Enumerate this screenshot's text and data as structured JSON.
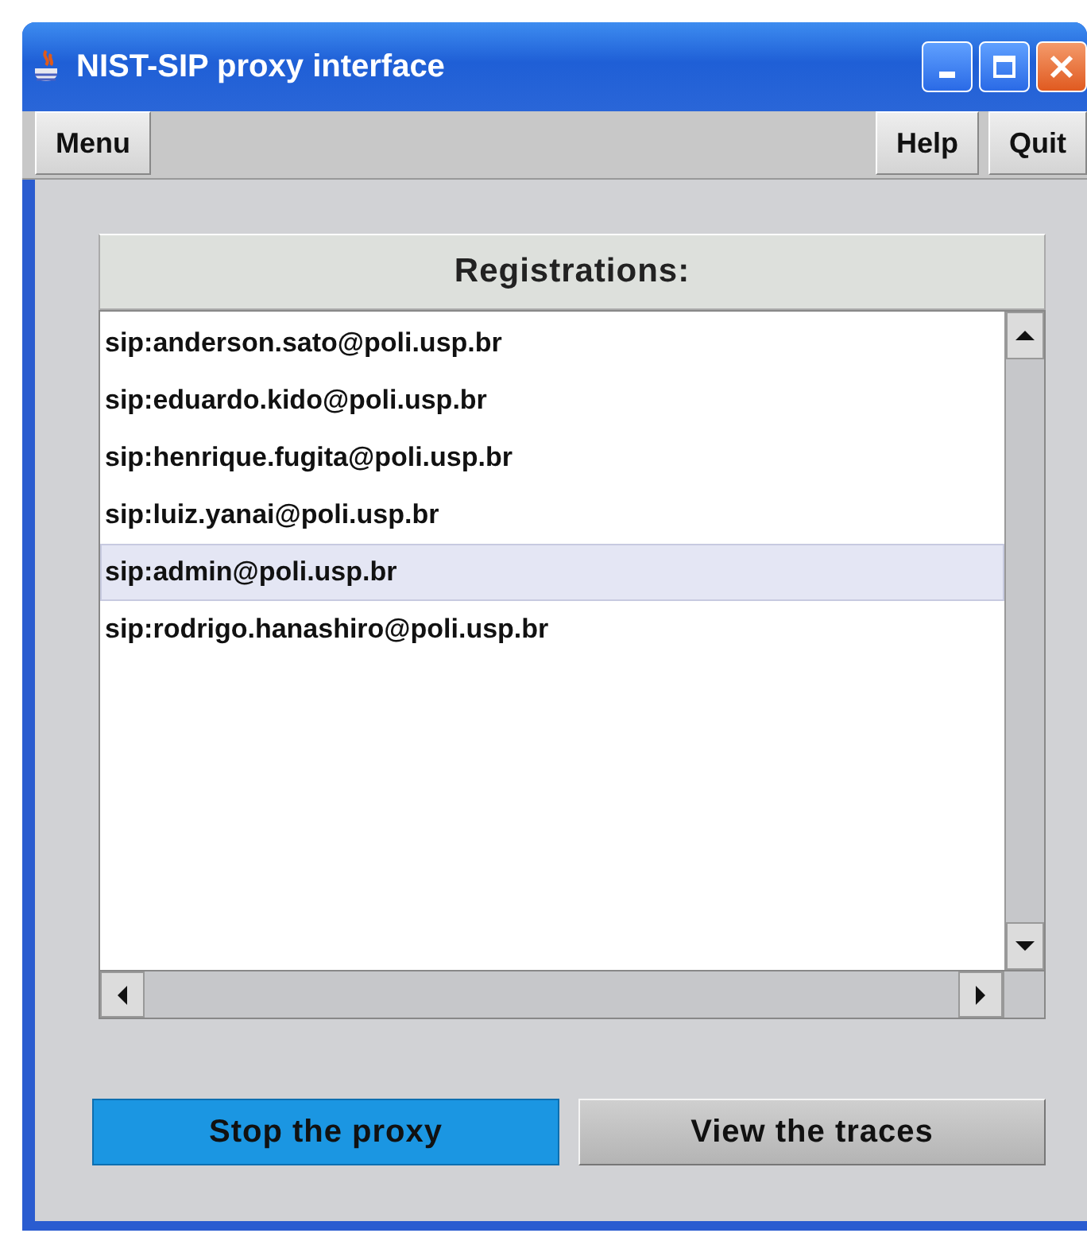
{
  "window": {
    "title": "NIST-SIP proxy interface"
  },
  "menu_bar": {
    "left": [
      {
        "label": "Menu"
      }
    ],
    "right": [
      {
        "label": "Help"
      },
      {
        "label": "Quit"
      }
    ]
  },
  "registrations": {
    "header": "Registrations:",
    "items": [
      {
        "label": "sip:anderson.sato@poli.usp.br",
        "selected": false
      },
      {
        "label": "sip:eduardo.kido@poli.usp.br",
        "selected": false
      },
      {
        "label": "sip:henrique.fugita@poli.usp.br",
        "selected": false
      },
      {
        "label": "sip:luiz.yanai@poli.usp.br",
        "selected": false
      },
      {
        "label": "sip:admin@poli.usp.br",
        "selected": true
      },
      {
        "label": "sip:rodrigo.hanashiro@poli.usp.br",
        "selected": false
      }
    ]
  },
  "buttons": [
    {
      "label": "Stop the proxy",
      "selected": true
    },
    {
      "label": "View the traces",
      "selected": false
    }
  ]
}
